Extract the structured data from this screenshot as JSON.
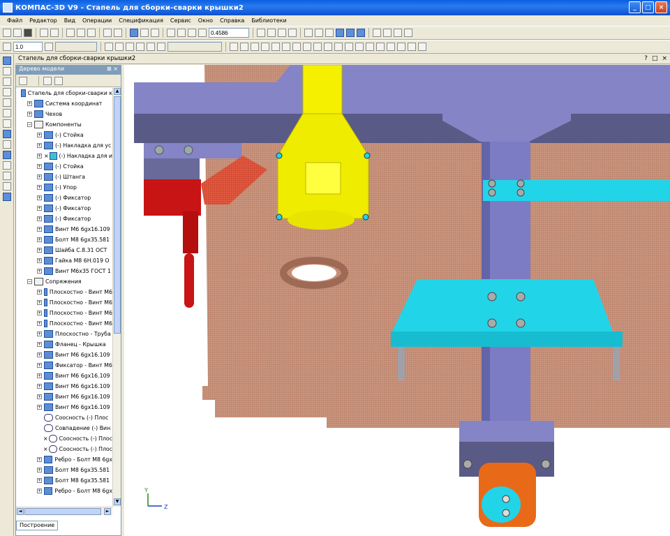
{
  "window": {
    "title": "КОМПАС-3D V9 - Стапель для сборки-сварки крышки2",
    "buttons": {
      "min": "_",
      "max": "□",
      "close": "×"
    }
  },
  "menu": [
    "Файл",
    "Редактор",
    "Вид",
    "Операции",
    "Спецификация",
    "Сервис",
    "Окно",
    "Справка",
    "Библиотеки"
  ],
  "toolbar": {
    "zoom_value": "0.4586",
    "step_value": "1.0"
  },
  "document_tab": {
    "label": "Стапель для сборки-сварки крышки2",
    "controls": [
      "?",
      "□",
      "×"
    ]
  },
  "tree_panel": {
    "header": "Дерево модели",
    "header_controls": "⊠ ×",
    "items": [
      {
        "text": "Стапель для сборки-сварки к",
        "level": 0,
        "exp": "",
        "chk": "",
        "icon": "assembly-icon"
      },
      {
        "text": "Система координат",
        "level": 1,
        "exp": "+",
        "chk": "",
        "icon": "coordinate-system-icon"
      },
      {
        "text": "Чехов",
        "level": 1,
        "exp": "+",
        "chk": "",
        "icon": "part-icon"
      },
      {
        "text": "Компоненты",
        "level": 1,
        "exp": "−",
        "chk": "",
        "icon": "components-folder-icon"
      },
      {
        "text": "(-) Стойка",
        "level": 2,
        "exp": "+",
        "chk": "",
        "icon": "part-icon"
      },
      {
        "text": "(-) Накладка для ус",
        "level": 2,
        "exp": "+",
        "chk": "",
        "icon": "part-icon"
      },
      {
        "text": "(-) Накладка для и",
        "level": 2,
        "exp": "+",
        "chk": "×",
        "icon": "part-cyan-icon"
      },
      {
        "text": "(-) Стойка",
        "level": 2,
        "exp": "+",
        "chk": "",
        "icon": "part-icon"
      },
      {
        "text": "(-) Штанга",
        "level": 2,
        "exp": "+",
        "chk": "",
        "icon": "part-icon"
      },
      {
        "text": "(-) Упор",
        "level": 2,
        "exp": "+",
        "chk": "",
        "icon": "part-icon"
      },
      {
        "text": "(-) Фиксатор",
        "level": 2,
        "exp": "+",
        "chk": "",
        "icon": "part-icon"
      },
      {
        "text": "(-) Фиксатор",
        "level": 2,
        "exp": "+",
        "chk": "",
        "icon": "part-icon"
      },
      {
        "text": "(-) Фиксатор",
        "level": 2,
        "exp": "+",
        "chk": "",
        "icon": "part-icon"
      },
      {
        "text": "Винт М6 6gx16.109",
        "level": 2,
        "exp": "+",
        "chk": "",
        "icon": "standard-part-icon"
      },
      {
        "text": "Болт М8 6gx35.581",
        "level": 2,
        "exp": "+",
        "chk": "",
        "icon": "standard-part-icon"
      },
      {
        "text": "Шайба С.8.31 ОСТ",
        "level": 2,
        "exp": "+",
        "chk": "",
        "icon": "standard-part-icon"
      },
      {
        "text": "Гайка М8 6Н.019 О",
        "level": 2,
        "exp": "+",
        "chk": "",
        "icon": "standard-part-icon"
      },
      {
        "text": "Винт М6x35 ГОСТ 1",
        "level": 2,
        "exp": "+",
        "chk": "",
        "icon": "standard-part-icon"
      },
      {
        "text": "Сопряжения",
        "level": 1,
        "exp": "−",
        "chk": "",
        "icon": "mates-folder-icon"
      },
      {
        "text": "Плоскостно - Винт М6",
        "level": 2,
        "exp": "+",
        "chk": "",
        "icon": "mate-icon"
      },
      {
        "text": "Плоскостно - Винт М6",
        "level": 2,
        "exp": "+",
        "chk": "",
        "icon": "mate-icon"
      },
      {
        "text": "Плоскостно - Винт М6",
        "level": 2,
        "exp": "+",
        "chk": "",
        "icon": "mate-icon"
      },
      {
        "text": "Плоскостно - Винт М6",
        "level": 2,
        "exp": "+",
        "chk": "",
        "icon": "mate-icon"
      },
      {
        "text": "Плоскостно - Труба",
        "level": 2,
        "exp": "+",
        "chk": "",
        "icon": "mate-icon"
      },
      {
        "text": "Фланец - Крышка",
        "level": 2,
        "exp": "+",
        "chk": "",
        "icon": "mate-icon"
      },
      {
        "text": "Винт М6 6gx16.109",
        "level": 2,
        "exp": "+",
        "chk": "",
        "icon": "mate-icon"
      },
      {
        "text": "Фиксатор - Винт М6",
        "level": 2,
        "exp": "+",
        "chk": "",
        "icon": "mate-icon"
      },
      {
        "text": "Винт М6 6gx16.109",
        "level": 2,
        "exp": "+",
        "chk": "",
        "icon": "mate-icon"
      },
      {
        "text": "Винт М6 6gx16.109",
        "level": 2,
        "exp": "+",
        "chk": "",
        "icon": "mate-icon"
      },
      {
        "text": "Винт М6 6gx16.109",
        "level": 2,
        "exp": "+",
        "chk": "",
        "icon": "mate-icon"
      },
      {
        "text": "Винт М6 6gx16.109",
        "level": 2,
        "exp": "+",
        "chk": "",
        "icon": "mate-icon"
      },
      {
        "text": "Соосность (-) Плос",
        "level": 2,
        "exp": "",
        "chk": "",
        "icon": "link-icon"
      },
      {
        "text": "Совпадение (-) Вин",
        "level": 2,
        "exp": "",
        "chk": "",
        "icon": "link-icon"
      },
      {
        "text": "Соосность (-) Плос",
        "level": 2,
        "exp": "",
        "chk": "×",
        "icon": "link-icon"
      },
      {
        "text": "Соосность (-) Плос",
        "level": 2,
        "exp": "",
        "chk": "×",
        "icon": "link-icon"
      },
      {
        "text": "Ребро - Болт М8 6gx",
        "level": 2,
        "exp": "+",
        "chk": "",
        "icon": "mate-icon"
      },
      {
        "text": "Болт М8 6gx35.581",
        "level": 2,
        "exp": "+",
        "chk": "",
        "icon": "mate-icon"
      },
      {
        "text": "Болт М8 6gx35.581",
        "level": 2,
        "exp": "+",
        "chk": "",
        "icon": "mate-icon"
      },
      {
        "text": "Ребро - Болт М8 6gx",
        "level": 2,
        "exp": "+",
        "chk": "",
        "icon": "mate-icon"
      }
    ],
    "bottom_tab": "Построение"
  },
  "viewport": {
    "axis_labels": {
      "y": "Y",
      "z": "Z"
    },
    "colors": {
      "background": "#ffffff",
      "plate": "#c08a72",
      "frame": "#8585c8",
      "frame_dark": "#55557a",
      "yellow": "#f5f000",
      "red": "#c81414",
      "cyan": "#22d4e8",
      "orange": "#e86a18",
      "gray": "#a0a0a8"
    }
  }
}
